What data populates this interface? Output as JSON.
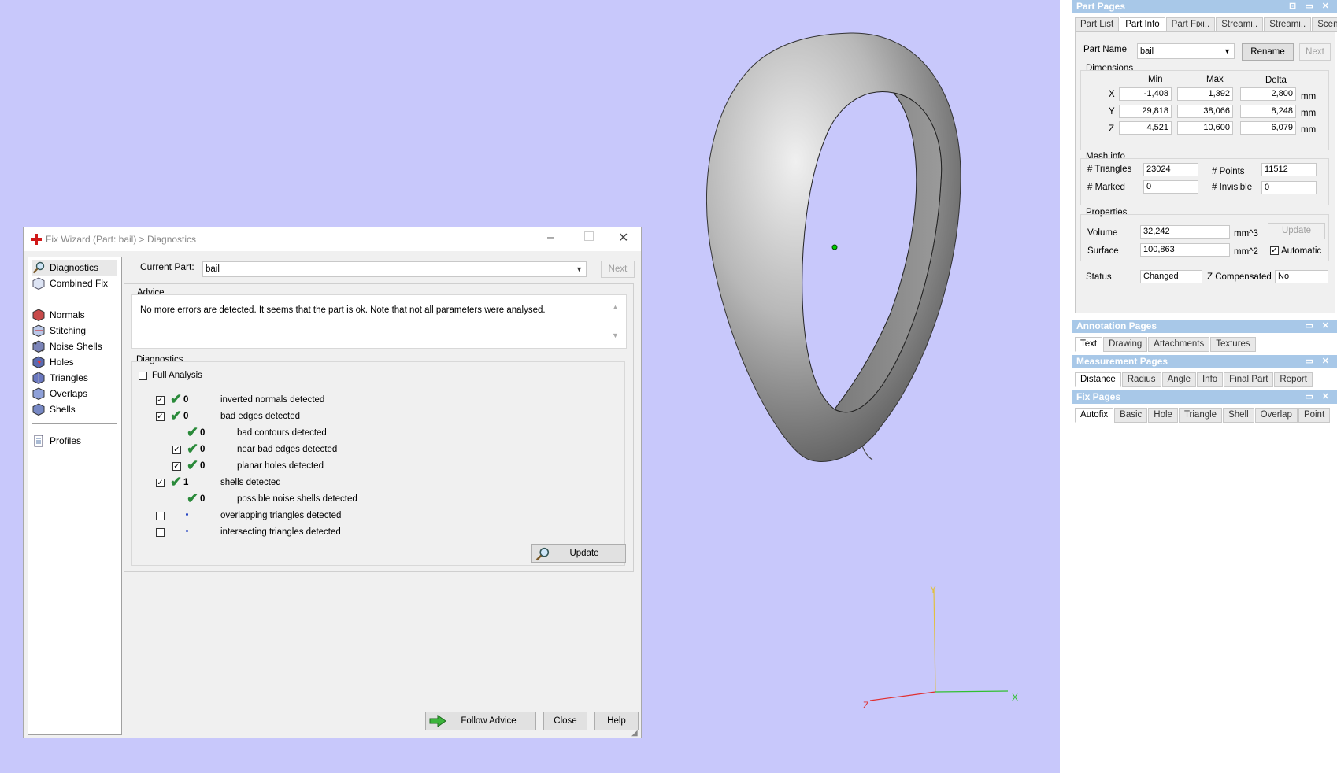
{
  "viewport": {
    "axes": {
      "x_label": "X",
      "y_label": "Y",
      "z_label": "Z"
    }
  },
  "part_pages": {
    "title": "Part Pages",
    "header_buttons": "⊡ ▭ ✕",
    "tabs": [
      "Part List",
      "Part Info",
      "Part Fixi..",
      "Streami..",
      "Streami..",
      "Scenes"
    ],
    "active_tab": "Part Info",
    "part_name_label": "Part Name",
    "part_name_value": "bail",
    "rename_label": "Rename",
    "next_label": "Next",
    "dimensions": {
      "title": "Dimensions",
      "col_min": "Min",
      "col_max": "Max",
      "col_delta": "Delta",
      "unit": "mm",
      "rows": [
        {
          "axis": "X",
          "min": "-1,408",
          "max": "1,392",
          "delta": "2,800"
        },
        {
          "axis": "Y",
          "min": "29,818",
          "max": "38,066",
          "delta": "8,248"
        },
        {
          "axis": "Z",
          "min": "4,521",
          "max": "10,600",
          "delta": "6,079"
        }
      ]
    },
    "mesh_info": {
      "title": "Mesh info",
      "triangles_label": "# Triangles",
      "triangles": "23024",
      "points_label": "# Points",
      "points": "11512",
      "marked_label": "# Marked",
      "marked": "0",
      "invisible_label": "# Invisible",
      "invisible": "0"
    },
    "properties": {
      "title": "Properties",
      "volume_label": "Volume",
      "volume": "32,242",
      "volume_unit": "mm^3",
      "update_label": "Update",
      "surface_label": "Surface",
      "surface": "100,863",
      "surface_unit": "mm^2",
      "automatic_label": "Automatic"
    },
    "status_label": "Status",
    "status_value": "Changed",
    "zcomp_label": "Z Compensated",
    "zcomp_value": "No"
  },
  "annotation_pages": {
    "title": "Annotation Pages",
    "header_buttons": "▭ ✕",
    "tabs": [
      "Text",
      "Drawing",
      "Attachments",
      "Textures"
    ]
  },
  "measurement_pages": {
    "title": "Measurement Pages",
    "header_buttons": "▭ ✕",
    "tabs": [
      "Distance",
      "Radius",
      "Angle",
      "Info",
      "Final Part",
      "Report"
    ]
  },
  "fix_pages": {
    "title": "Fix Pages",
    "header_buttons": "▭ ✕",
    "tabs": [
      "Autofix",
      "Basic",
      "Hole",
      "Triangle",
      "Shell",
      "Overlap",
      "Point"
    ]
  },
  "fix_wizard": {
    "title": "Fix Wizard (Part: bail) > Diagnostics",
    "nav": {
      "top": [
        "Diagnostics",
        "Combined Fix"
      ],
      "middle": [
        "Normals",
        "Stitching",
        "Noise Shells",
        "Holes",
        "Triangles",
        "Overlaps",
        "Shells"
      ],
      "bottom": [
        "Profiles"
      ]
    },
    "current_part_label": "Current Part:",
    "current_part_value": "bail",
    "next_label": "Next",
    "advice_title": "Advice",
    "advice_text": "No more errors are detected. It seems that the part is ok. Note that not all parameters were analysed.",
    "diagnostics_title": "Diagnostics",
    "full_analysis_label": "Full Analysis",
    "rows": [
      {
        "count": "0",
        "text": "inverted normals detected"
      },
      {
        "count": "0",
        "text": "bad edges detected"
      },
      {
        "count": "0",
        "text": "bad contours detected"
      },
      {
        "count": "0",
        "text": "near bad edges detected"
      },
      {
        "count": "0",
        "text": "planar holes detected"
      },
      {
        "count": "1",
        "text": "shells detected"
      },
      {
        "count": "0",
        "text": "possible noise shells detected"
      },
      {
        "count": "",
        "text": "overlapping triangles detected"
      },
      {
        "count": "",
        "text": "intersecting triangles detected"
      }
    ],
    "update_label": "Update",
    "follow_advice_label": "Follow Advice",
    "close_label": "Close",
    "help_label": "Help"
  }
}
